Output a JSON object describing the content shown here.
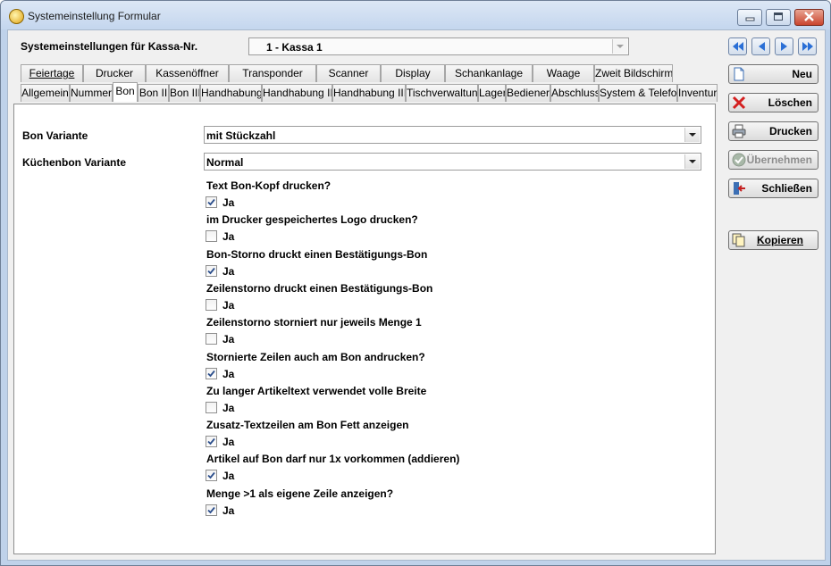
{
  "window": {
    "title": "Systemeinstellung Formular"
  },
  "header": {
    "kassa_label": "Systemeinstellungen für Kassa-Nr.",
    "kassa_value": "1 - Kassa 1"
  },
  "tabs_row1": [
    "Feiertage",
    "Drucker",
    "Kassenöffner",
    "Transponder",
    "Scanner",
    "Display",
    "Schankanlage",
    "Waage",
    "Zweit Bildschirm"
  ],
  "tabs_row2": [
    "Allgemein",
    "Nummern",
    "Bon",
    "Bon II",
    "Bon III",
    "Handhabung",
    "Handhabung II",
    "Handhabung III",
    "Tischverwaltung",
    "Lager",
    "Bediener",
    "Abschluss",
    "System & Telefon",
    "Inventur"
  ],
  "active_tab": "Bon",
  "form": {
    "bon_variante_label": "Bon Variante",
    "bon_variante_value": "mit Stückzahl",
    "kuechenbon_label": "Küchenbon Variante",
    "kuechenbon_value": "Normal",
    "options": [
      {
        "label": "Text Bon-Kopf drucken?",
        "check": "Ja",
        "checked": true
      },
      {
        "label": "im Drucker gespeichertes Logo drucken?",
        "check": "Ja",
        "checked": false
      },
      {
        "label": "Bon-Storno druckt einen Bestätigungs-Bon",
        "check": "Ja",
        "checked": true
      },
      {
        "label": "Zeilenstorno druckt einen Bestätigungs-Bon",
        "check": "Ja",
        "checked": false
      },
      {
        "label": "Zeilenstorno storniert nur jeweils Menge 1",
        "check": "Ja",
        "checked": false
      },
      {
        "label": "Stornierte Zeilen auch am Bon andrucken?",
        "check": "Ja",
        "checked": true
      },
      {
        "label": "Zu langer Artikeltext verwendet volle Breite",
        "check": "Ja",
        "checked": false
      },
      {
        "label": "Zusatz-Textzeilen am Bon Fett anzeigen",
        "check": "Ja",
        "checked": true
      },
      {
        "label": "Artikel auf Bon darf nur 1x vorkommen (addieren)",
        "check": "Ja",
        "checked": true
      },
      {
        "label": "Menge >1 als eigene Zeile anzeigen?",
        "check": "Ja",
        "checked": true
      }
    ]
  },
  "side_buttons": {
    "neu": "Neu",
    "loeschen": "Löschen",
    "drucken": "Drucken",
    "uebernehmen": "Übernehmen",
    "schliessen": "Schließen",
    "kopieren": "Kopieren"
  },
  "colors": {
    "nav_blue": "#2a6fd6",
    "delete_red": "#d42020",
    "check_blue": "#2b4e8c"
  }
}
